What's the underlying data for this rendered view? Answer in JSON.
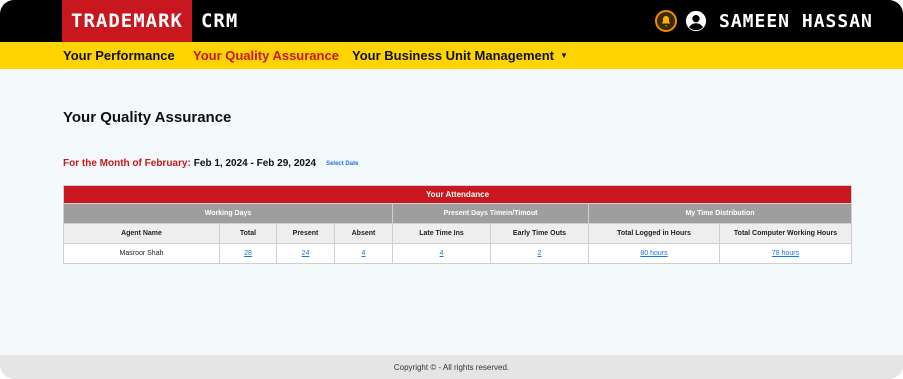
{
  "brand": {
    "name": "TRADEMARK",
    "suffix": "CRM"
  },
  "user": {
    "name": "SAMEEN HASSAN"
  },
  "nav": [
    {
      "label": "Your Performance"
    },
    {
      "label": "Your Quality Assurance",
      "active": true
    },
    {
      "label": "Your Business Unit Management",
      "caret": "▼"
    }
  ],
  "page": {
    "title": "Your Quality Assurance",
    "month_label": "For the Month of February:",
    "month_range": "Feb 1, 2024 - Feb 29, 2024",
    "select_date": "Select Date"
  },
  "attendance": {
    "title": "Your Attendance",
    "groups": [
      "Working Days",
      "Present Days Timein/Timout",
      "My Time Distribution"
    ],
    "columns": [
      "Agent Name",
      "Total",
      "Present",
      "Absent",
      "Late Time Ins",
      "Early Time Outs",
      "Total Logged in Hours",
      "Total Computer Working Hours"
    ],
    "row": {
      "agent": "Masroor Shah",
      "total": "28",
      "present": "24",
      "absent": "4",
      "late": "4",
      "early": "2",
      "logged": "80 hours",
      "computer": "78 hours"
    }
  },
  "footer": {
    "text": "Copyright © - All rights reserved."
  },
  "colors": {
    "brand_red": "#c8171e",
    "nav_yellow": "#ffd400",
    "link_blue": "#1a73e8",
    "group_gray": "#9e9e9e"
  },
  "icons": [
    "bell-icon",
    "user-circle-icon",
    "chevron-down-icon"
  ]
}
